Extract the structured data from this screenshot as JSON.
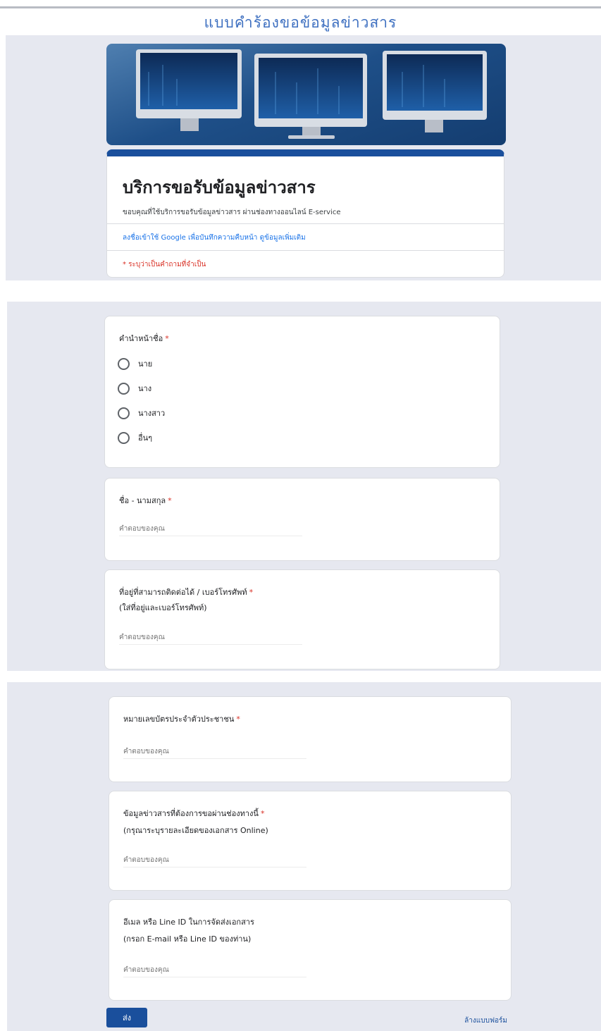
{
  "page": {
    "heading": "แบบคำร้องขอข้อมูลข่าวสาร"
  },
  "header": {
    "title": "บริการขอรับข้อมูลข่าวสาร",
    "description": "ขอบคุณที่ใช้บริการขอรับข้อมูลข่าวสาร ผ่านช่องทางออนไลน์ E-service",
    "account_text": "ลงชื่อเข้าใช้ Google เพื่อบันทึกความคืบหน้า",
    "account_link": "ดูข้อมูลเพิ่มเติม",
    "required_note": "* ระบุว่าเป็นคำถามที่จำเป็น"
  },
  "questions": {
    "prefix": {
      "title": "คำนำหน้าชื่อ",
      "required_mark": "*",
      "options": [
        "นาย",
        "นาง",
        "นางสาว",
        "อื่นๆ"
      ]
    },
    "name": {
      "title": "ชื่อ - นามสกุล",
      "required_mark": "*",
      "placeholder": "คำตอบของคุณ"
    },
    "address": {
      "title": "ที่อยู่ที่สามารถติดต่อได้ / เบอร์โทรศัพท์",
      "required_mark": "*",
      "subtitle": "(ใส่ที่อยู่และเบอร์โทรศัพท์)",
      "placeholder": "คำตอบของคุณ"
    },
    "id_card": {
      "title": "หมายเลขบัตรประจำตัวประชาชน",
      "required_mark": "*",
      "placeholder": "คำตอบของคุณ"
    },
    "document": {
      "title": "ข้อมูลข่าวสารที่ต้องการขอผ่านช่องทางนี้",
      "required_mark": "*",
      "subtitle": "(กรุณาระบุรายละเอียดของเอกสาร Online)",
      "placeholder": "คำตอบของคุณ"
    },
    "contact": {
      "title": "อีเมล หรือ Line ID ในการจัดส่งเอกสาร",
      "subtitle": "(กรอก E-mail หรือ Line ID ของท่าน)",
      "placeholder": "คำตอบของคุณ"
    }
  },
  "footer": {
    "submit_label": "ส่ง",
    "clear_label": "ล้างแบบฟอร์ม"
  },
  "colors": {
    "accent": "#1a4f9c",
    "heading": "#3d6fc0",
    "required": "#d93025",
    "band": "#e6e8f0"
  }
}
